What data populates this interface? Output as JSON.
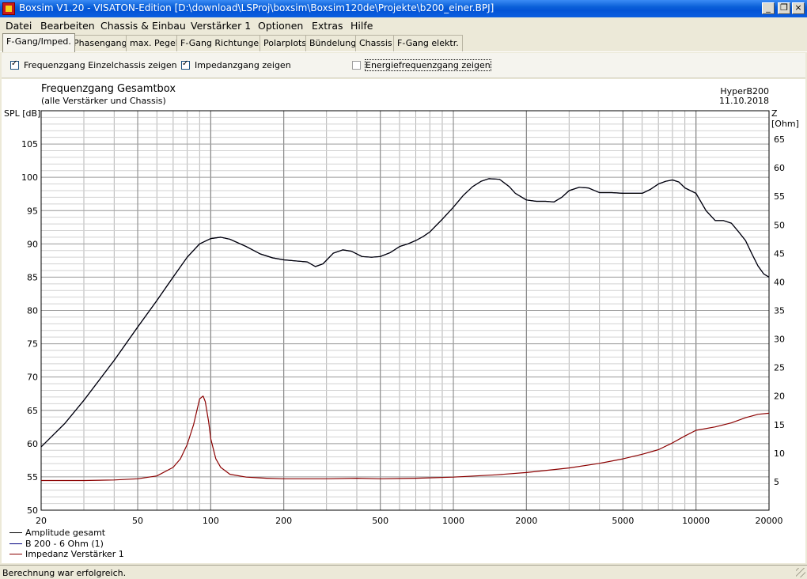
{
  "window": {
    "title": "Boxsim V1.20 - VISATON-Edition [D:\\download\\LSProj\\boxsim\\Boxsim120de\\Projekte\\b200_einer.BPJ]",
    "icon": "app-logo-icon",
    "buttons": {
      "minimize": "_",
      "maximize": "❐",
      "close": "×"
    }
  },
  "menu": [
    "Datei",
    "Bearbeiten",
    "Chassis & Einbau",
    "Verstärker 1",
    "Optionen",
    "Extras",
    "Hilfe"
  ],
  "tabs": [
    {
      "label": "F-Gang/Imped.",
      "active": true
    },
    {
      "label": "Phasengang",
      "active": false
    },
    {
      "label": "max. Pegel",
      "active": false
    },
    {
      "label": "F-Gang Richtungen",
      "active": false
    },
    {
      "label": "Polarplots",
      "active": false
    },
    {
      "label": "Bündelung",
      "active": false
    },
    {
      "label": "Chassis",
      "active": false
    },
    {
      "label": "F-Gang elektr.",
      "active": false
    }
  ],
  "options": [
    {
      "label": "Frequenzgang Einzelchassis zeigen",
      "checked": true
    },
    {
      "label": "Impedanzgang zeigen",
      "checked": true
    },
    {
      "label": "Energiefrequenzgang zeigen",
      "checked": false
    }
  ],
  "status": "Berechnung war erfolgreich.",
  "chart_data": {
    "type": "line",
    "title": "Frequenzgang Gesamtbox",
    "subtitle": "(alle Verstärker und Chassis)",
    "model": "HyperB200",
    "date": "11.10.2018",
    "ylabel_left": "SPL [dB]",
    "ylabel_right": "Z [Ohm]",
    "x_scale": "log",
    "xlim": [
      20,
      20000
    ],
    "ylim_left": [
      50,
      110
    ],
    "ylim_right": [
      0,
      70
    ],
    "x_ticks": [
      20,
      50,
      100,
      200,
      500,
      1000,
      2000,
      5000,
      10000,
      20000
    ],
    "y_ticks_left": [
      50,
      55,
      60,
      65,
      70,
      75,
      80,
      85,
      90,
      95,
      100,
      105
    ],
    "y_ticks_right": [
      5,
      10,
      15,
      20,
      25,
      30,
      35,
      40,
      45,
      50,
      55,
      60,
      65
    ],
    "grid": true,
    "legend_position": "bottom-left",
    "series": [
      {
        "name": "Amplitude gesamt",
        "axis": "left",
        "color": "#000000",
        "x": [
          20,
          25,
          30,
          40,
          50,
          60,
          70,
          80,
          90,
          100,
          110,
          120,
          140,
          160,
          180,
          200,
          230,
          250,
          270,
          290,
          320,
          350,
          380,
          420,
          460,
          500,
          550,
          600,
          650,
          700,
          750,
          800,
          900,
          1000,
          1100,
          1200,
          1300,
          1400,
          1550,
          1700,
          1800,
          2000,
          2200,
          2400,
          2600,
          2800,
          3000,
          3300,
          3600,
          4000,
          4500,
          5000,
          6000,
          6500,
          7000,
          7500,
          8000,
          8500,
          9000,
          10000,
          11000,
          12000,
          13000,
          14000,
          15000,
          16000,
          17000,
          18000,
          19000,
          20000
        ],
        "values": [
          59.5,
          63.0,
          66.5,
          72.5,
          77.5,
          81.5,
          85.0,
          88.0,
          90.0,
          90.8,
          91.0,
          90.7,
          89.6,
          88.5,
          87.9,
          87.6,
          87.4,
          87.3,
          86.6,
          87.0,
          88.6,
          89.1,
          88.9,
          88.1,
          88.0,
          88.1,
          88.7,
          89.6,
          90.0,
          90.5,
          91.1,
          91.8,
          93.7,
          95.5,
          97.3,
          98.6,
          99.4,
          99.8,
          99.7,
          98.6,
          97.6,
          96.6,
          96.4,
          96.4,
          96.3,
          97.0,
          98.0,
          98.5,
          98.4,
          97.7,
          97.7,
          97.6,
          97.6,
          98.2,
          99.0,
          99.4,
          99.6,
          99.3,
          98.4,
          97.6,
          95.0,
          93.5,
          93.5,
          93.1,
          91.8,
          90.5,
          88.5,
          86.7,
          85.5,
          85.0
        ]
      },
      {
        "name": "B 200 - 6 Ohm (1)",
        "axis": "left",
        "color": "#000080",
        "x": [
          20,
          20000
        ],
        "values": [
          59.5,
          85.0
        ]
      },
      {
        "name": "Impedanz Verstärker 1",
        "axis": "right",
        "color": "#8b0000",
        "x": [
          20,
          30,
          40,
          50,
          60,
          70,
          75,
          80,
          85,
          90,
          93,
          95,
          98,
          100,
          105,
          110,
          120,
          140,
          170,
          200,
          300,
          400,
          500,
          700,
          1000,
          1500,
          2000,
          3000,
          4000,
          5000,
          6000,
          7000,
          8000,
          9000,
          10000,
          12000,
          14000,
          16000,
          18000,
          20000
        ],
        "values": [
          5.2,
          5.2,
          5.3,
          5.5,
          6.0,
          7.5,
          9.0,
          11.5,
          15.0,
          19.5,
          20.0,
          19.0,
          15.5,
          12.5,
          9.0,
          7.5,
          6.3,
          5.8,
          5.6,
          5.5,
          5.5,
          5.6,
          5.5,
          5.6,
          5.8,
          6.2,
          6.6,
          7.4,
          8.2,
          9.0,
          9.8,
          10.6,
          11.8,
          13.0,
          14.0,
          14.6,
          15.3,
          16.2,
          16.8,
          17.0
        ]
      }
    ]
  }
}
